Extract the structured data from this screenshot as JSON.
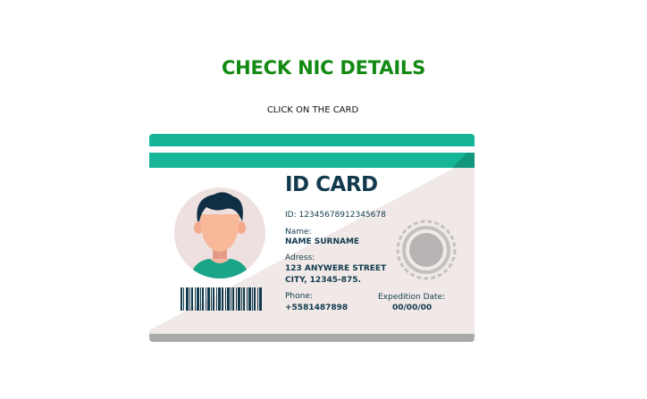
{
  "page": {
    "title": "CHECK NIC DETAILS",
    "subtitle": "CLICK ON THE CARD"
  },
  "card": {
    "heading": "ID CARD",
    "id_line": "ID: 12345678912345678",
    "name_label": "Name:",
    "name_value": "NAME SURNAME",
    "address_label": "Adress:",
    "address_line1": "123 ANYWERE STREET",
    "address_line2": "CITY, 12345-875.",
    "phone_label": "Phone:",
    "phone_value": "+5581487898",
    "expedition_label": "Expedition  Date:",
    "expedition_value": "00/00/00"
  },
  "icons": [
    "person-avatar-icon",
    "seal-icon",
    "barcode-icon"
  ],
  "colors": {
    "title": "#128a12",
    "stripe": "#17b597",
    "card_text": "#123a4d",
    "card_shade": "#f0e9e8"
  }
}
